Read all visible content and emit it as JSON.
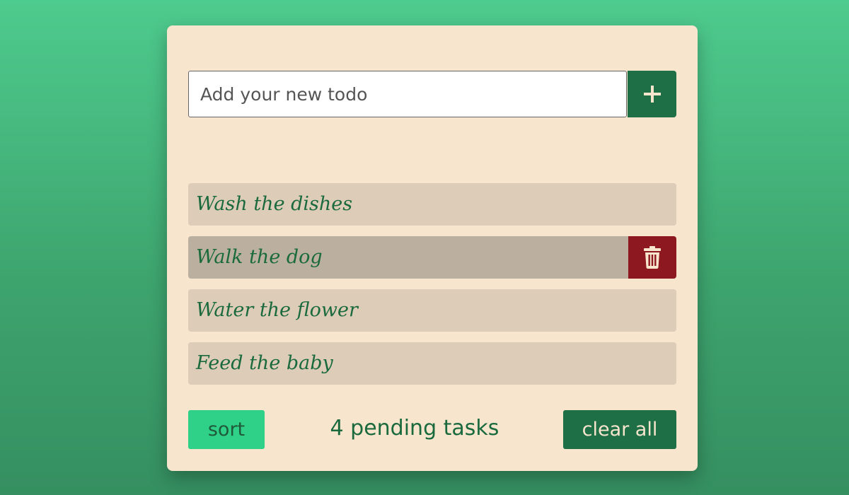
{
  "input": {
    "placeholder": "Add your new todo",
    "value": ""
  },
  "add_button": {
    "icon": "plus-icon"
  },
  "todos": [
    {
      "text": "Wash the dishes"
    },
    {
      "text": "Walk the dog",
      "hovered": true,
      "action_icon": "trash-icon"
    },
    {
      "text": "Water the flower"
    },
    {
      "text": "Feed the baby"
    }
  ],
  "footer": {
    "sort_label": "sort",
    "pending_text": "4 pending tasks",
    "clear_label": "clear all"
  },
  "colors": {
    "background_top": "#4ecb8e",
    "background_bottom": "#358f60",
    "card": "#f7e5cd",
    "primary_green": "#1e6e46",
    "item_bg": "#ddccb7",
    "item_hover_bg": "#bbb0a0",
    "delete_red": "#8e1820",
    "sort_green": "#2fd087",
    "text_green": "#1a6a3e"
  }
}
